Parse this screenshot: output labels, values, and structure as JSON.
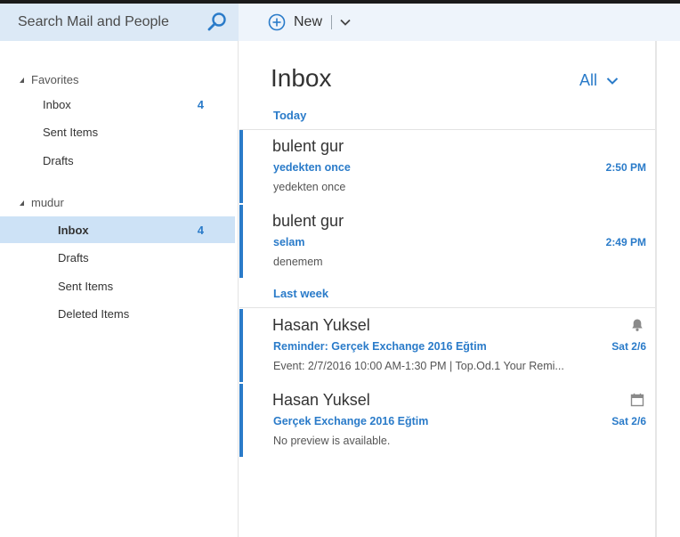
{
  "search": {
    "placeholder": "Search Mail and People"
  },
  "toolbar": {
    "new_label": "New"
  },
  "folders": {
    "favorites_label": "Favorites",
    "favorites": [
      {
        "label": "Inbox",
        "count": "4"
      },
      {
        "label": "Sent Items",
        "count": ""
      },
      {
        "label": "Drafts",
        "count": ""
      }
    ],
    "account_label": "mudur",
    "account": [
      {
        "label": "Inbox",
        "count": "4",
        "selected": true
      },
      {
        "label": "Drafts",
        "count": ""
      },
      {
        "label": "Sent Items",
        "count": ""
      },
      {
        "label": "Deleted Items",
        "count": ""
      }
    ]
  },
  "message_list": {
    "title": "Inbox",
    "filter_label": "All",
    "groups": [
      {
        "label": "Today",
        "messages": [
          {
            "sender": "bulent gur",
            "subject": "yedekten once",
            "time": "2:50 PM",
            "preview": "yedekten once",
            "icon": ""
          },
          {
            "sender": "bulent gur",
            "subject": "selam",
            "time": "2:49 PM",
            "preview": "denemem",
            "icon": ""
          }
        ]
      },
      {
        "label": "Last week",
        "messages": [
          {
            "sender": "Hasan Yuksel",
            "subject": "Reminder: Gerçek Exchange 2016 Eğtim",
            "time": "Sat 2/6",
            "preview": "Event: 2/7/2016 10:00 AM-1:30 PM | Top.Od.1 Your Remi...",
            "icon": "bell-icon"
          },
          {
            "sender": "Hasan Yuksel",
            "subject": "Gerçek Exchange 2016 Eğtim",
            "time": "Sat 2/6",
            "preview": "No preview is available.",
            "icon": "calendar-icon"
          }
        ]
      }
    ]
  },
  "colors": {
    "accent": "#2a7bc9",
    "selected_bg": "#cde2f6",
    "search_bg": "#dce9f6"
  }
}
